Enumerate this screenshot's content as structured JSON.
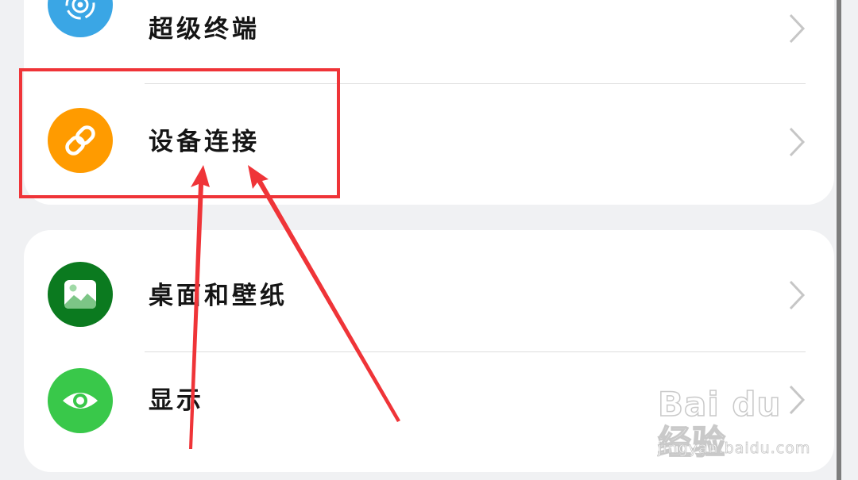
{
  "settings": {
    "items": [
      {
        "label": "超级终端",
        "icon": "super-device-icon",
        "color": "#3aa6e5"
      },
      {
        "label": "设备连接",
        "icon": "link-icon",
        "color": "#ff9b00"
      },
      {
        "label": "桌面和壁纸",
        "icon": "image-icon",
        "color": "#0b7a1f"
      },
      {
        "label": "显示",
        "icon": "eye-icon",
        "color": "#39c84a"
      }
    ]
  },
  "annotation": {
    "color": "#ef3438"
  },
  "watermark": {
    "brand": "Bai du 经验",
    "url": "jingyan.baidu.com"
  }
}
